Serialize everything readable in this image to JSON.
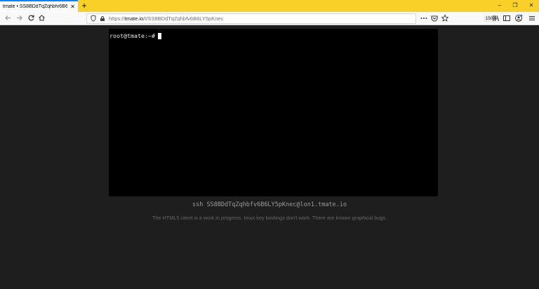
{
  "browser": {
    "tab": {
      "title": "tmate • SS8BDdTqZqhbfv6B6LY5pKnec",
      "close_glyph": "✕"
    },
    "new_tab_glyph": "+",
    "window_controls": {
      "minimize": "–",
      "restore": "❐",
      "close": "✕"
    },
    "url": {
      "prefix": "https://",
      "host": "tmate.io",
      "path": "/t/SS8BDdTqZqhbfv6B6LY5pKnec"
    },
    "zoom": "150%",
    "icons": {
      "back": "back-arrow-icon",
      "forward": "forward-arrow-icon",
      "reload": "reload-icon",
      "home": "home-icon",
      "shield": "tracking-shield-icon",
      "lock": "lock-icon",
      "more": "more-icon",
      "pocket": "pocket-icon",
      "star": "bookmark-star-icon",
      "library": "library-icon",
      "sidebar": "sidebar-icon",
      "account": "account-icon",
      "menu": "hamburger-menu-icon"
    }
  },
  "terminal": {
    "prompt": "root@tmate:~#"
  },
  "page": {
    "ssh_command": "ssh SS8BDdTqZqhbfv6B6LY5pKnec@lon1.tmate.io",
    "notice": "The HTML5 client is a work in progress. tmux key bindings don't work. There are known graphical bugs."
  },
  "colors": {
    "tabbar": "#f9d028",
    "tab_accent": "#0a84ff",
    "page_bg": "#1e1e1e",
    "terminal_bg": "#000000"
  }
}
